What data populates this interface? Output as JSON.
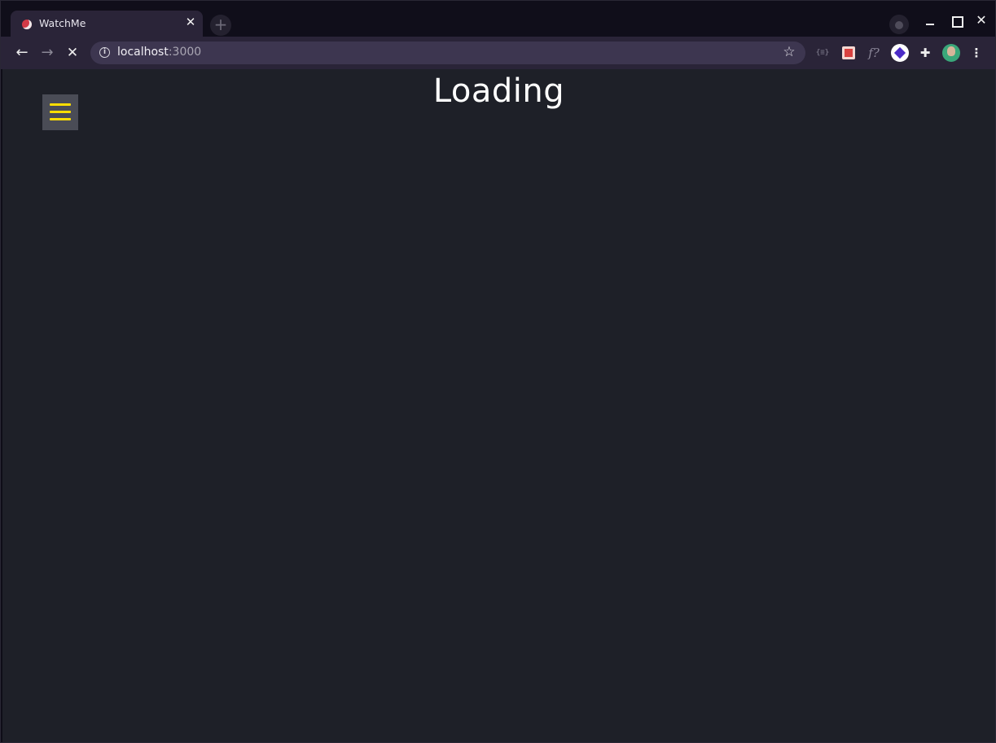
{
  "browser": {
    "tab": {
      "title": "WatchMe",
      "close_glyph": "✕",
      "favicon": "watchme-favicon-icon"
    },
    "new_tab_glyph": "+",
    "window_controls": {
      "close_glyph": "✕"
    },
    "toolbar": {
      "back_glyph": "←",
      "forward_glyph": "→",
      "stop_glyph": "✕",
      "info_glyph": "i",
      "url_host": "localhost",
      "url_port": ":3000",
      "star_glyph": "☆",
      "extensions": {
        "braces_label": "{≡}",
        "fx_label": "f?",
        "puzzle_glyph": "✚",
        "menu_glyph": "⋮"
      }
    }
  },
  "page": {
    "title": "Loading",
    "colors": {
      "background": "#1e2028",
      "menu_button_bg": "#4a4c56",
      "menu_icon": "#ffde00"
    }
  }
}
